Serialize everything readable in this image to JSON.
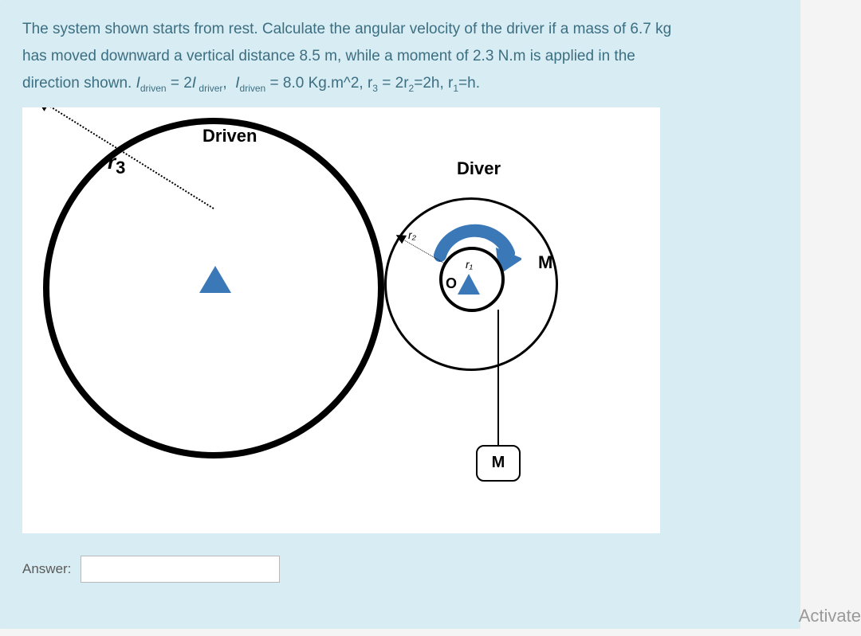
{
  "question": {
    "line1": "The system shown starts from rest. Calculate the angular velocity of the driver if a mass of 6.7 kg",
    "line2": "has moved downward a vertical distance 8.5 m, while a moment of 2.3 N.m is applied in the",
    "line3_pre": "direction shown.  ",
    "formula_plain": "I_driven = 2 I_driver,  I_driven = 8.0 Kg.m^2, r3 = 2r2 = 2h, r1 = h."
  },
  "values": {
    "mass_kg": 6.7,
    "distance_m": 8.5,
    "moment_Nm": 2.3,
    "I_driven_kgm2": 8.0,
    "I_relation": "I_driven = 2 * I_driver",
    "r_relation": "r3 = 2*r2 = 2h, r1 = h"
  },
  "diagram": {
    "driven_label": "Driven",
    "diver_label": "Diver",
    "r3_label": "r",
    "r3_sub": "3",
    "r2_label": "r₂",
    "r1_label": "r₁",
    "o_label": "O",
    "moment_label": "M",
    "mass_label": "M"
  },
  "answer": {
    "label": "Answer:",
    "value": ""
  },
  "watermark": "Activate"
}
